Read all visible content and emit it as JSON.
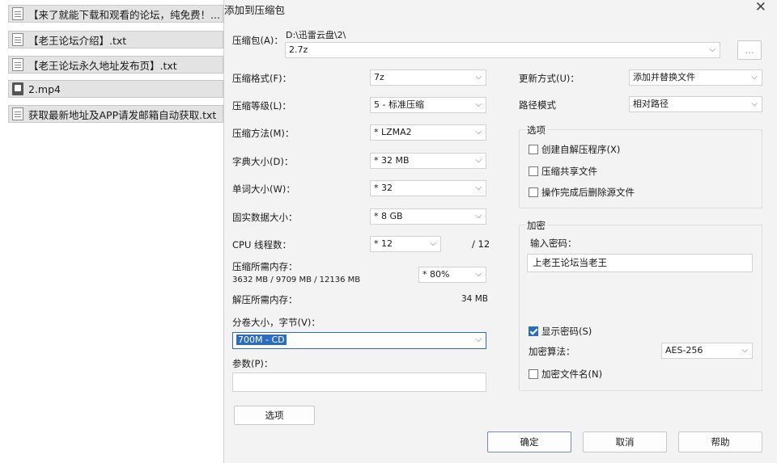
{
  "files": [
    {
      "name": "【来了就能下载和观看的论坛，纯免费！...",
      "type": "doc"
    },
    {
      "name": "【老王论坛介绍】.txt",
      "type": "doc"
    },
    {
      "name": "【老王论坛永久地址发布页】.txt",
      "type": "doc"
    },
    {
      "name": "2.mp4",
      "type": "video"
    },
    {
      "name": "获取最新地址及APP请发邮箱自动获取.txt",
      "type": "doc"
    }
  ],
  "dialog": {
    "title": "添加到压缩包",
    "close": "✕",
    "archive_label": "压缩包(A)：",
    "archive_path": "D:\\迅雷云盘\\2\\",
    "archive_name": "2.7z",
    "browse": "...",
    "format_label": "压缩格式(F)：",
    "format_value": "7z",
    "level_label": "压缩等级(L)：",
    "level_value": "5 - 标准压缩",
    "method_label": "压缩方法(M)：",
    "method_value": "* LZMA2",
    "dict_label": "字典大小(D)：",
    "dict_value": "* 32 MB",
    "word_label": "单词大小(W)：",
    "word_value": "* 32",
    "solid_label": "固实数据大小：",
    "solid_value": "* 8 GB",
    "cpu_label": "CPU 线程数：",
    "cpu_value": "* 12",
    "cpu_total": "/ 12",
    "mem_label": "压缩所需内存：",
    "mem_value": "3632 MB / 9709 MB / 12136 MB",
    "mem_percent": "* 80%",
    "decomp_label": "解压所需内存：",
    "decomp_value": "34 MB",
    "split_label": "分卷大小，字节(V)：",
    "split_value": "700M - CD",
    "params_label": "参数(P)：",
    "params_value": "",
    "options_button": "选项",
    "update_label": "更新方式(U)：",
    "update_value": "添加并替换文件",
    "path_label": "路径模式",
    "path_value": "相对路径",
    "options_group": "选项",
    "opt_sfx": "创建自解压程序(X)",
    "opt_shared": "压缩共享文件",
    "opt_delete": "操作完成后删除源文件",
    "encrypt_group": "加密",
    "password_label": "输入密码：",
    "password_value": "上老王论坛当老王",
    "show_password": "显示密码(S)",
    "enc_method_label": "加密算法：",
    "enc_method_value": "AES-256",
    "encrypt_names": "加密文件名(N)",
    "ok": "确定",
    "cancel": "取消",
    "help": "帮助"
  }
}
